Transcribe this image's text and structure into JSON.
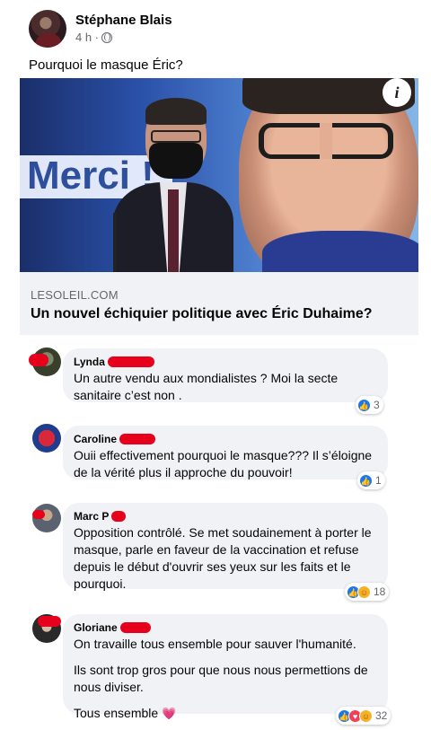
{
  "post": {
    "author": "Stéphane Blais",
    "time": "4 h ·",
    "globe_icon": "globe-icon",
    "text": "Pourquoi le masque Éric?"
  },
  "link_card": {
    "image_text": "Merci !",
    "info_icon": "i",
    "domain": "LESOLEIL.COM",
    "title": "Un nouvel échiquier politique avec Éric Duhaime?"
  },
  "comments": [
    {
      "name": "Lynda",
      "text": [
        "Un autre vendu aux mondialistes ? Moi la secte sanitaire c’est non ."
      ],
      "reactions": [
        "like"
      ],
      "count": "3"
    },
    {
      "name": "Caroline",
      "text": [
        "Ouii effectivement pourquoi le masque??? Il s’éloigne de la vérité plus il approche du pouvoir!"
      ],
      "reactions": [
        "like"
      ],
      "count": "1"
    },
    {
      "name": "Marc P",
      "text": [
        "Opposition contrôlé. Se met soudainement à porter le masque, parle en faveur de la vaccination et refuse depuis le début d'ouvrir ses yeux sur les faits et le pourquoi."
      ],
      "reactions": [
        "like",
        "care"
      ],
      "count": "18"
    },
    {
      "name": "Gloriane",
      "text": [
        "On travaille tous ensemble pour sauver l'humanité.",
        "Ils sont trop gros pour que nous nous permettions de nous diviser.",
        "Tous ensemble"
      ],
      "heart": "💗",
      "reactions": [
        "like",
        "love",
        "care"
      ],
      "count": "32"
    }
  ],
  "colors": {
    "redaction": "#e6001c",
    "bubble": "#f0f2f5",
    "like": "#1877f2",
    "love": "#f33e58",
    "care": "#f7b125"
  }
}
